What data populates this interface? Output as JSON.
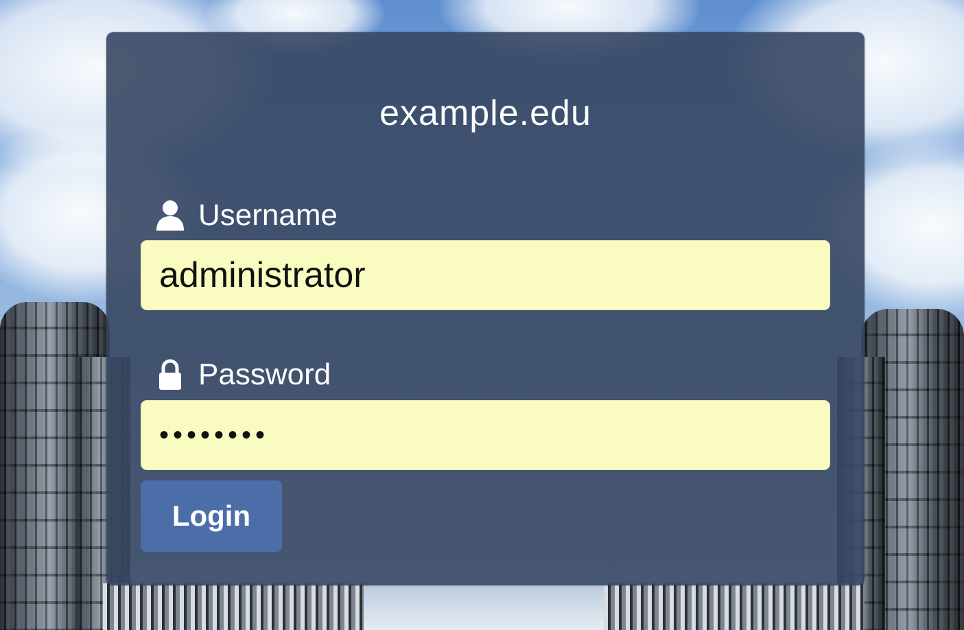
{
  "login": {
    "title": "example.edu",
    "username": {
      "label": "Username",
      "value": "administrator",
      "icon": "user-icon"
    },
    "password": {
      "label": "Password",
      "masked_value": "••••••••",
      "icon": "lock-icon"
    },
    "submit_label": "Login"
  },
  "colors": {
    "panel_background": "#374763",
    "input_background": "#fafbc0",
    "button_background": "#4c6ea8",
    "text_light": "#ffffff"
  }
}
